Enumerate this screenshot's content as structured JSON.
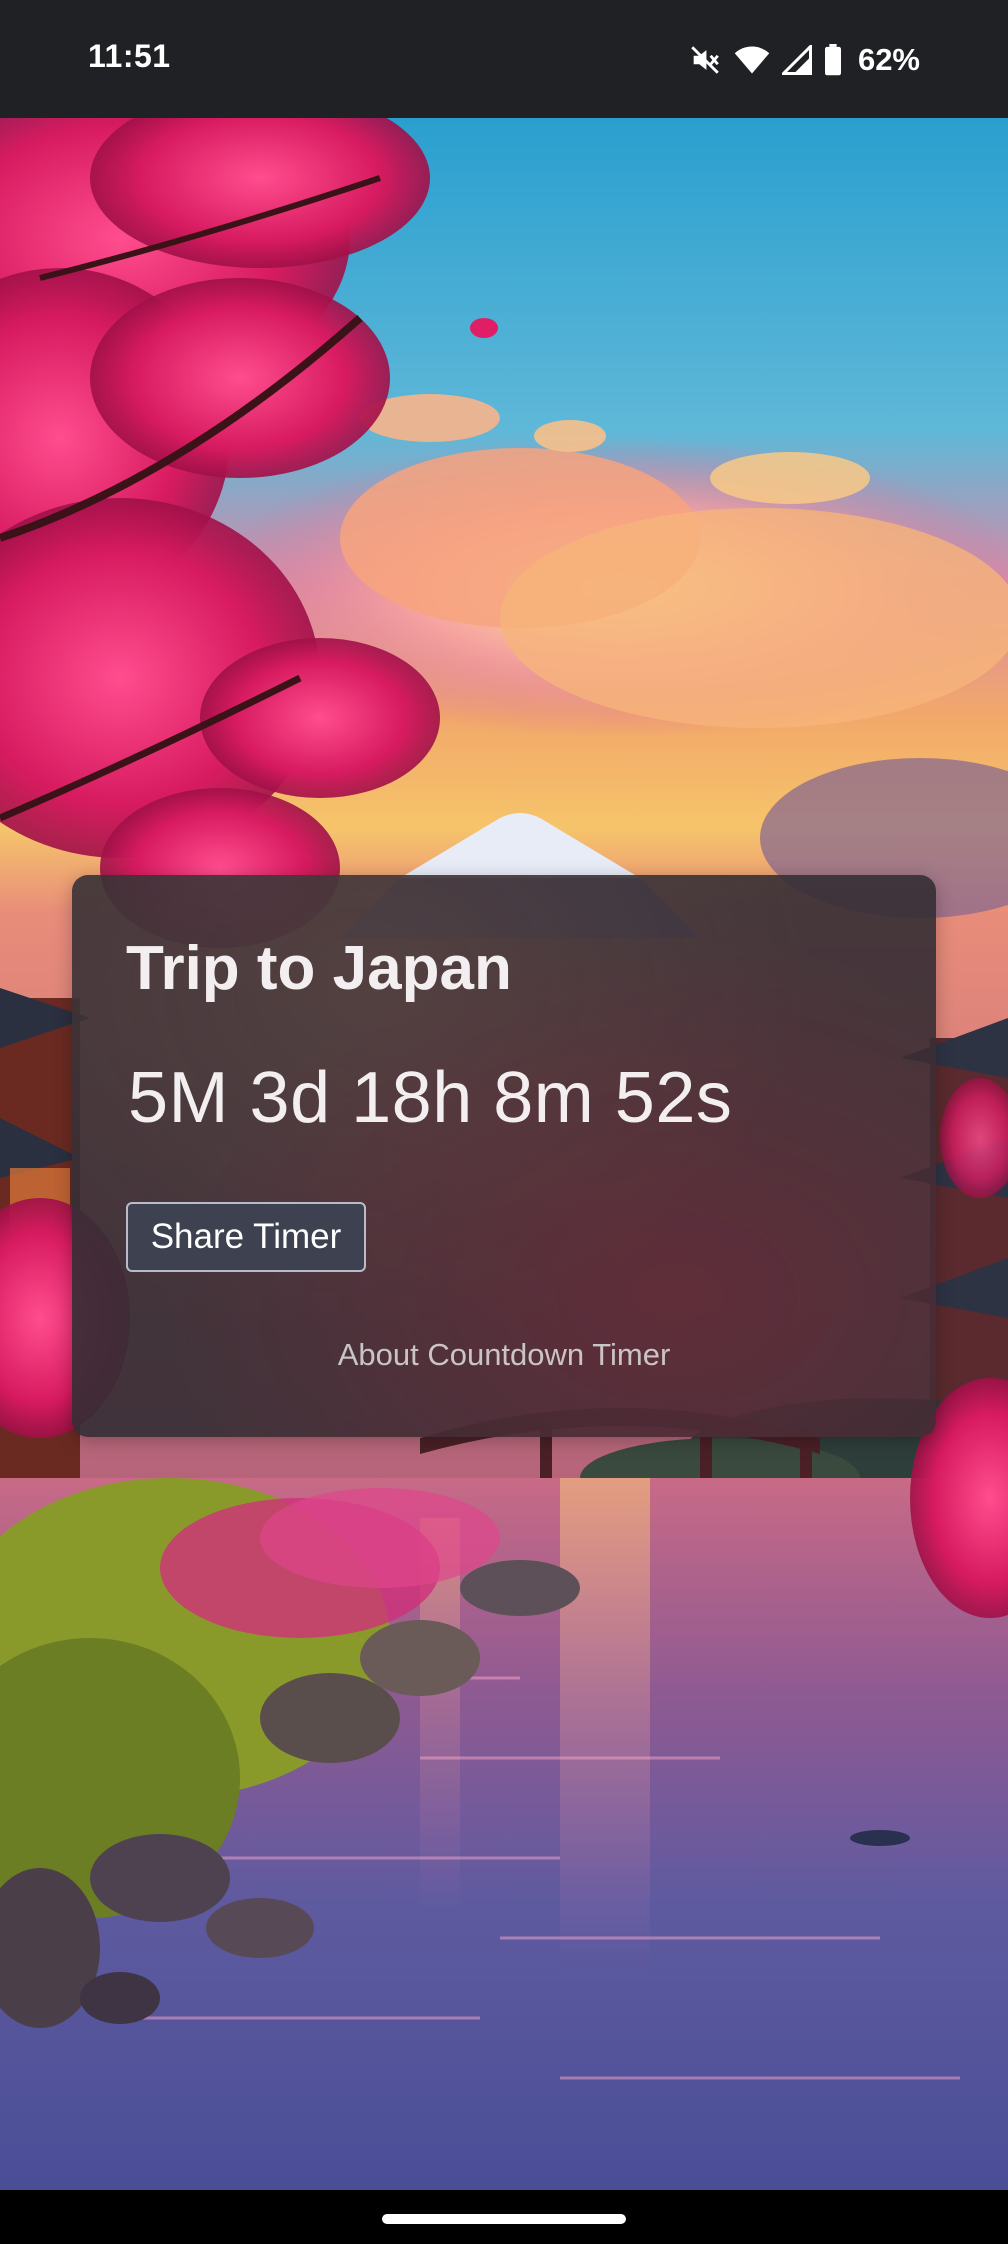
{
  "status_bar": {
    "time": "11:51",
    "battery": "62%",
    "icons": [
      "mute-icon",
      "wifi-icon",
      "cell-signal-icon",
      "battery-icon"
    ]
  },
  "card": {
    "title": "Trip to Japan",
    "countdown": "5M 3d 18h 8m 52s",
    "share_label": "Share Timer",
    "about_label": "About Countdown Timer"
  },
  "colors": {
    "status_bar_bg": "#1f2124",
    "card_bg": "#342e34",
    "button_bg": "#3d4150",
    "text": "#f3eef0",
    "muted_text": "#c9c4c6"
  }
}
